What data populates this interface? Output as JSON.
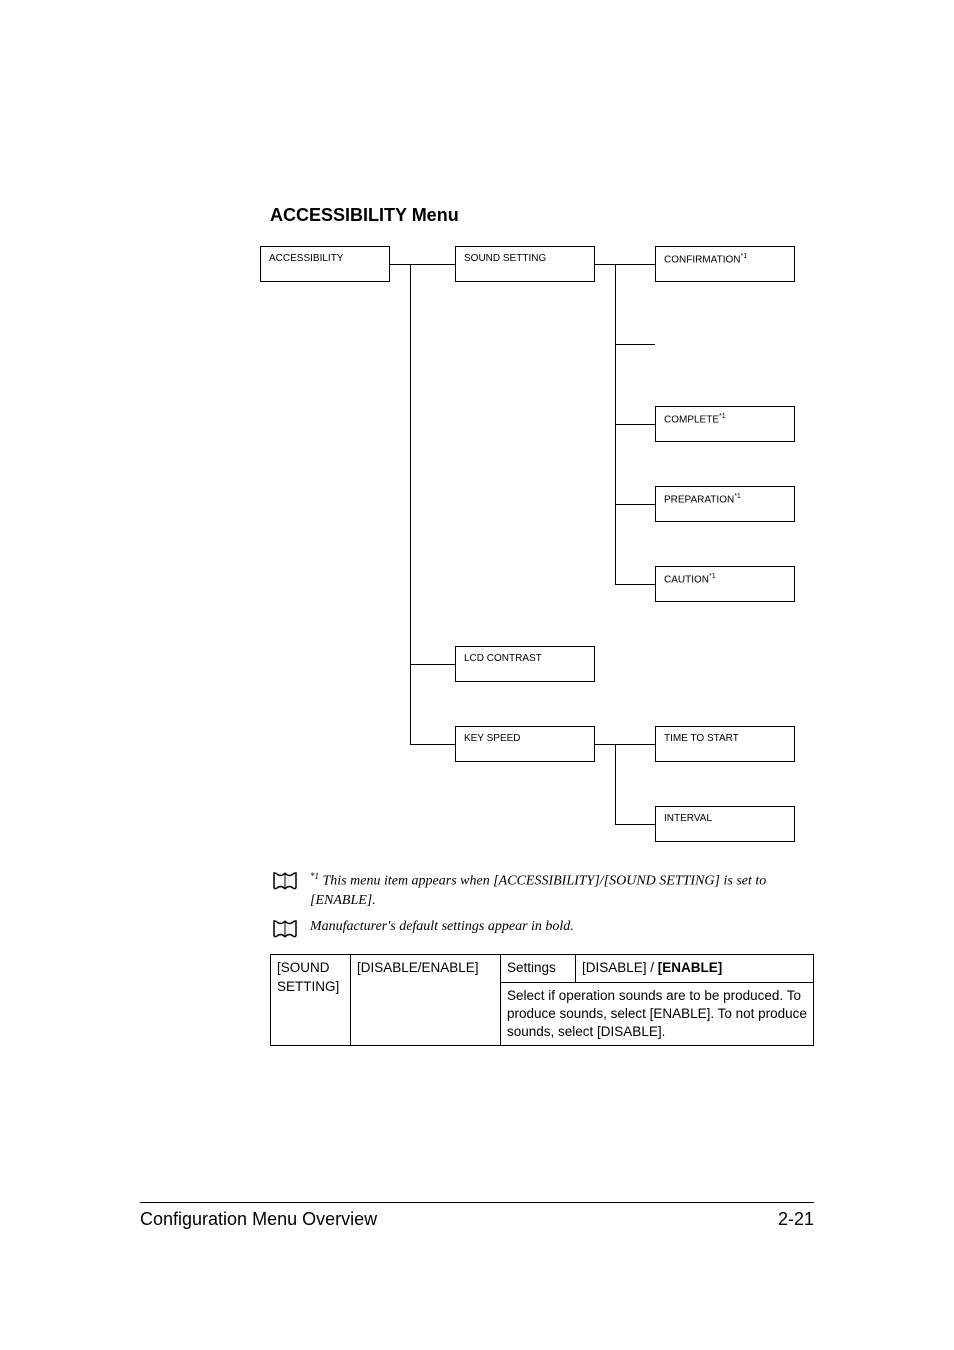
{
  "title": "ACCESSIBILITY Menu",
  "diagram": {
    "root": "ACCESSIBILITY",
    "sound_setting": "SOUND SETTING",
    "disable_enable": "DISABLE/ENABLE",
    "confirmation": "CONFIRMATION",
    "complete": "COMPLETE",
    "preparation": "PREPARATION",
    "caution": "CAUTION",
    "sup": "*1",
    "lcd_contrast": "LCD CONTRAST",
    "key_speed": "KEY SPEED",
    "time_to_start": "TIME TO START",
    "interval": "INTERVAL"
  },
  "notes": {
    "n1_sup": "*1",
    "n1": " This menu item appears when [ACCESSIBILITY]/[SOUND SETTING] is set to [ENABLE].",
    "n2": "Manufacturer's default settings appear in bold."
  },
  "table": {
    "r1c1a": "[SOUND",
    "r1c1b": "SETTING]",
    "r1c2": "[DISABLE/ENABLE]",
    "r1c3": "Settings",
    "r1c4a": "[DISABLE] / ",
    "r1c4b": "[ENABLE]",
    "r2desc": "Select if operation sounds are to be produced. To produce sounds, select [ENABLE]. To not produce sounds, select [DISABLE]."
  },
  "footer": {
    "left": "Configuration Menu Overview",
    "right": "2-21"
  }
}
